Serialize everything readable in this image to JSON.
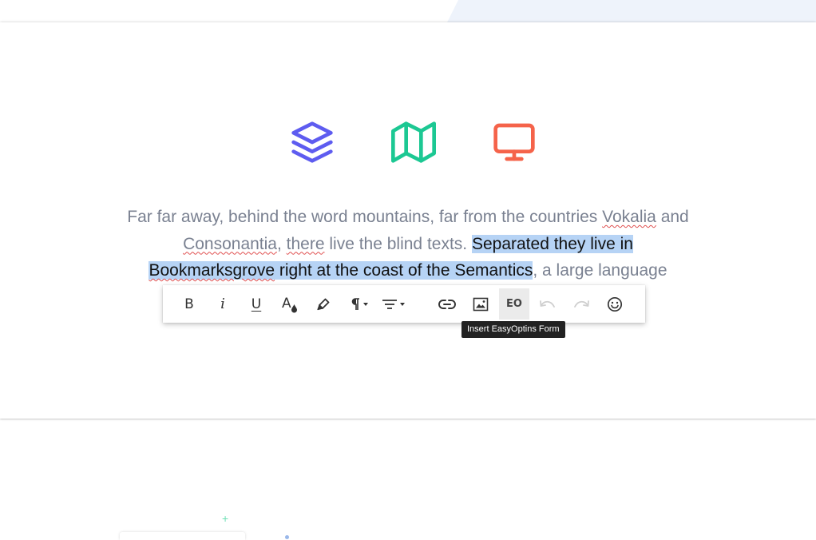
{
  "colors": {
    "layers_icon": "#5e5cf0",
    "map_icon": "#1cc893",
    "monitor_icon": "#f5634a",
    "selection": "#b6d3f5",
    "body_text": "#7a8191",
    "spellcheck": "#e05050"
  },
  "features": {
    "icons": [
      "layers-icon",
      "map-icon",
      "monitor-icon"
    ]
  },
  "paragraph": {
    "t1": "Far far away, behind the word mountains, far from the countries ",
    "vokalia": "Vokalia",
    "t2": " and ",
    "consonantia": "Consonantia",
    "t3": ", ",
    "there": "there",
    "t4": " live the blind texts. ",
    "sel1": "Separated they live in ",
    "bookmarksgrove": "Bookmarksgrove",
    "sel2": " right at the coast of the Semantics",
    "t5": ", a large language"
  },
  "toolbar": {
    "bold": "B",
    "italic": "i",
    "underline": "U",
    "font_color": "A",
    "easyoptins": "EO",
    "buttons": [
      "bold",
      "italic",
      "underline",
      "font-color",
      "highlight",
      "paragraph-format",
      "align",
      "insert-link",
      "insert-image",
      "insert-easyoptins-form",
      "undo",
      "redo",
      "emoticons"
    ]
  },
  "tooltip": {
    "text": "Insert EasyOptins Form"
  }
}
